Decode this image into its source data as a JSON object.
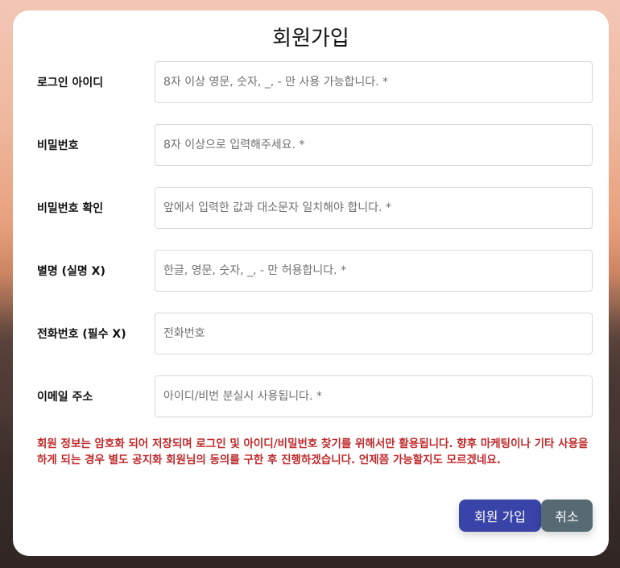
{
  "form": {
    "title": "회원가입",
    "fields": [
      {
        "label": "로그인 아이디",
        "placeholder": "8자 이상 영문, 숫자, _, - 만 사용 가능합니다. *"
      },
      {
        "label": "비밀번호",
        "placeholder": "8자 이상으로 입력해주세요. *"
      },
      {
        "label": "비밀번호 확인",
        "placeholder": "앞에서 입력한 값과 대소문자 일치해야 합니다. *"
      },
      {
        "label": "별명 (실명 X)",
        "placeholder": "한글, 영문, 숫자, _, - 만 허용합니다. *"
      },
      {
        "label": "전화번호 (필수 X)",
        "placeholder": "전화번호"
      },
      {
        "label": "이메일 주소",
        "placeholder": "아이디/비번 분실시 사용됩니다. *"
      }
    ],
    "notice": "회원 정보는 암호화 되어 저장되며 로그인 및 아이디/비밀번호 찾기를 위해서만 활용됩니다. 향후 마케팅이나 기타 사용을 하게 되는 경우 별도 공지화 회원님의 동의를 구한 후 진행하겠습니다. 언제쯤 가능할지도 모르겠네요.",
    "submit_label": "회원 가입",
    "cancel_label": "취소"
  },
  "colors": {
    "primary_button": "#3944a8",
    "secondary_button": "#566a73",
    "notice_text": "#c0292b"
  }
}
